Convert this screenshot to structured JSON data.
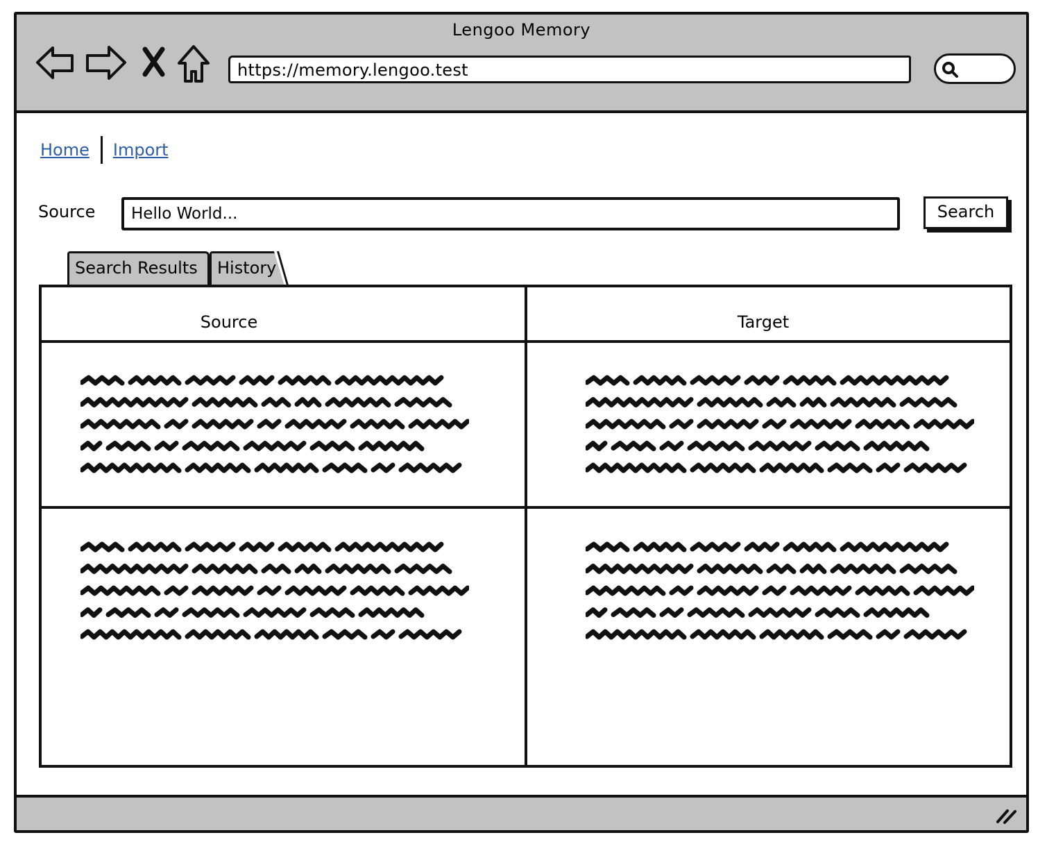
{
  "window": {
    "title": "Lengoo Memory"
  },
  "toolbar": {
    "back_icon": "back-arrow-icon",
    "forward_icon": "forward-arrow-icon",
    "stop_icon": "close-icon",
    "home_icon": "home-icon",
    "url": "https://memory.lengoo.test",
    "search_icon": "search-icon"
  },
  "nav": {
    "links": [
      {
        "label": "Home"
      },
      {
        "label": "Import"
      }
    ]
  },
  "search": {
    "label": "Source",
    "input_value": "Hello World...",
    "button_label": "Search"
  },
  "tabs": [
    {
      "label": "Search Results",
      "selected": true
    },
    {
      "label": "History",
      "selected": false
    }
  ],
  "results_table": {
    "columns": [
      "Source",
      "Target"
    ],
    "rows": [
      {
        "source": "placeholder-text-scribble",
        "target": "placeholder-text-scribble"
      },
      {
        "source": "placeholder-text-scribble",
        "target": "placeholder-text-scribble"
      }
    ]
  },
  "colors": {
    "chrome_gray": "#c2c2c2",
    "link_blue": "#2b5ea7",
    "ink": "#111111"
  }
}
